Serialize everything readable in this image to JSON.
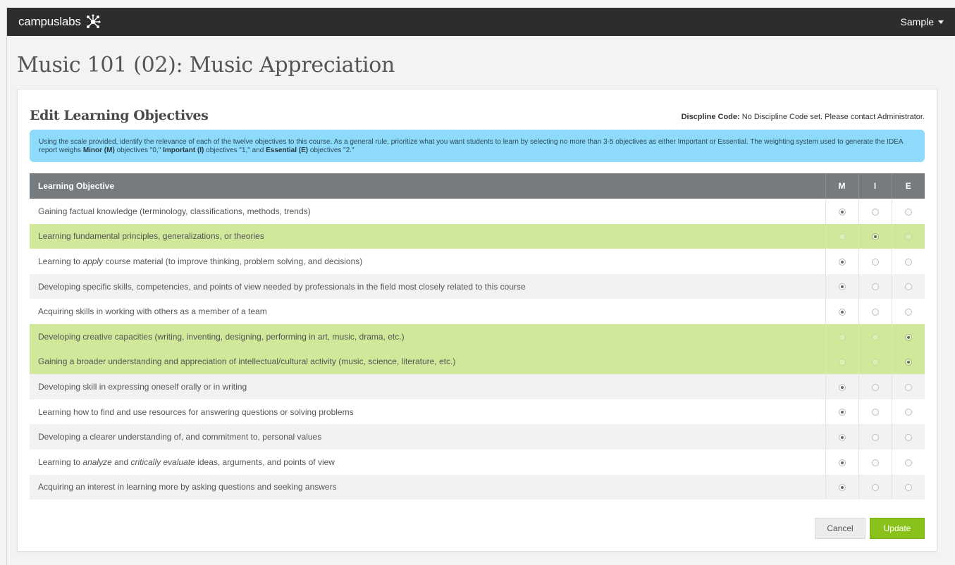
{
  "nav": {
    "brand": "campuslabs",
    "user": "Sample"
  },
  "page": {
    "title": "Music 101 (02): Music Appreciation"
  },
  "panel": {
    "title": "Edit Learning Objectives",
    "discipline_label": "Discpline Code:",
    "discipline_value": "No Discipline Code set. Please contact Administrator."
  },
  "info": {
    "text1": "Using the scale provided, identify the relevance of each of the twelve objectives to this course. As a general rule, prioritize what you want students to learn by selecting no more than 3-5 objectives as either Important or Essential. The weighting system used to generate the IDEA report weighs ",
    "minor": "Minor (M)",
    "text2": " objectives \"0,\" ",
    "important": "Important (I)",
    "text3": " objectives \"1,\" and ",
    "essential": "Essential (E)",
    "text4": " objectives \"2.\""
  },
  "table": {
    "header": "Learning Objective",
    "col_m": "M",
    "col_i": "I",
    "col_e": "E",
    "rows": [
      {
        "pre": "Gaining factual knowledge (terminology, classifications, methods, trends)",
        "selected": "M"
      },
      {
        "pre": "Learning fundamental principles, generalizations, or theories",
        "selected": "I"
      },
      {
        "pre": "Learning to ",
        "em1": "apply",
        "mid": " course material (to improve thinking, problem solving, and decisions)",
        "selected": "M"
      },
      {
        "pre": "Developing specific skills, competencies, and points of view needed by professionals in the field most closely related to this course",
        "selected": "M"
      },
      {
        "pre": "Acquiring skills in working with others as a member of a team",
        "selected": "M"
      },
      {
        "pre": "Developing creative capacities (writing, inventing, designing, performing in art, music, drama, etc.)",
        "selected": "E"
      },
      {
        "pre": "Gaining a broader understanding and appreciation of intellectual/cultural activity (music, science, literature, etc.)",
        "selected": "E"
      },
      {
        "pre": "Developing skill in expressing oneself orally or in writing",
        "selected": "M"
      },
      {
        "pre": "Learning how to find and use resources for answering questions or solving problems",
        "selected": "M"
      },
      {
        "pre": "Developing a clearer understanding of, and commitment to, personal values",
        "selected": "M"
      },
      {
        "pre": "Learning to ",
        "em1": "analyze",
        "mid": " and ",
        "em2": "critically evaluate",
        "post": " ideas, arguments, and points of view",
        "selected": "M"
      },
      {
        "pre": "Acquiring an interest in learning more by asking questions and seeking answers",
        "selected": "M"
      }
    ]
  },
  "actions": {
    "cancel": "Cancel",
    "update": "Update"
  },
  "colors": {
    "topbar": "#2d2d2d",
    "info_bg": "#8edafa",
    "header_bg": "#757b7e",
    "highlight": "#cfe899",
    "update_btn": "#8ac21c"
  }
}
